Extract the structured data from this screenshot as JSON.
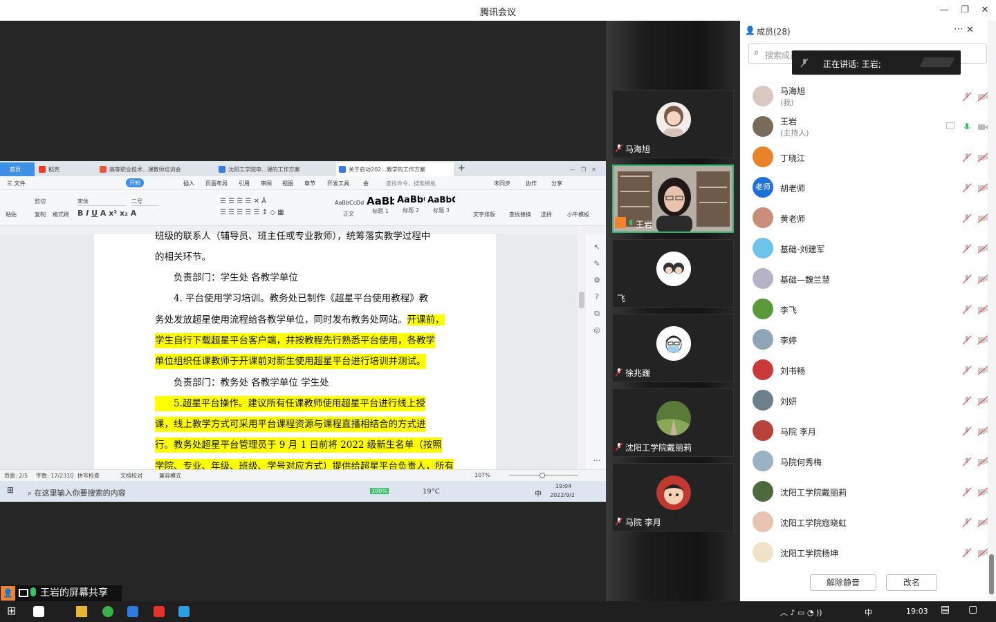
{
  "window": {
    "title": "腾讯会议"
  },
  "shared_screen": {
    "label": "王岩的屏幕共享",
    "wps_tabs": [
      "首页",
      "稻壳",
      "高等职业技术...课教师培训会",
      "沈阳工学院申...课的工作方案",
      "关于启动202...教学的工作方案"
    ],
    "menu": [
      "三 文件",
      "开始",
      "插入",
      "页面布局",
      "引用",
      "审阅",
      "视图",
      "章节",
      "开发工具",
      "会",
      "查找命令、搜索模板",
      "未同步",
      "协作",
      "分享"
    ],
    "ribbon": {
      "paste": "粘贴",
      "cut": "剪切",
      "copy": "复制",
      "format_painter": "格式刷",
      "font": "宋体",
      "size": "二号",
      "styles": [
        "正文",
        "标题 1",
        "标题 2",
        "标题 3"
      ],
      "style_previews": [
        "AaBbCcDd",
        "AaBb",
        "AaBbC",
        "AaBbC"
      ],
      "text_layout": "文字排版",
      "find_replace": "查找替换",
      "select": "选择",
      "template": "小牛模板"
    },
    "doc_lines": [
      {
        "text": "班级的联系人（辅导员、班主任或专业教师），统筹落实教学过程中",
        "hl": false
      },
      {
        "text": "的相关环节。",
        "hl": false
      },
      {
        "text": "　　负责部门：学生处 各教学单位",
        "hl": false
      },
      {
        "text": "　　4. 平台使用学习培训。教务处已制作《超星平台使用教程》教",
        "hl": false
      },
      {
        "text": "务处发放超星使用流程给各教学单位，同时发布教务处网站。",
        "hl": false,
        "hl_tail": "开课前，"
      },
      {
        "text": "学生自行下载超星平台客户端，并按教程先行熟悉平台使用，各教学",
        "hl": true
      },
      {
        "text": "单位组织任课教师于开课前对新生使用超星平台进行培训并测试。",
        "hl": true
      },
      {
        "text": "　　负责部门：教务处 各教学单位 学生处",
        "hl": false
      },
      {
        "text": "　　5.超星平台操作。建议所有任课教师使用超星平台进行线上授",
        "hl": true
      },
      {
        "text": "课，线上教学方式可采用平台课程资源与课程直播相结合的方式进",
        "hl": true
      },
      {
        "text": "行。教务处超星平台管理员于 9 月 1 日前将 2022 级新生名单（按照",
        "hl": true
      },
      {
        "text": "学院、专业、年级、班级、学号对应方式）提供给超星平台负责人，所有",
        "hl": true
      }
    ],
    "status": {
      "page": "页面: 2/5",
      "words": "字数: 17/2310",
      "spell": "拼写检查",
      "proof": "文档校对",
      "mode": "兼容模式",
      "zoom": "107%"
    },
    "win_taskbar": {
      "search": "在这里输入你要搜索的内容",
      "battery": "100%",
      "temp": "19°C",
      "ime": "中",
      "time": "19:04",
      "date": "2022/9/2"
    }
  },
  "gallery": [
    {
      "name": "马海旭",
      "avatar": "girl",
      "muted": true
    },
    {
      "name": "王岩",
      "avatar": "video",
      "muted": false,
      "active": true
    },
    {
      "name": "飞",
      "avatar": "couple",
      "muted": false
    },
    {
      "name": "徐兆巍",
      "avatar": "mask",
      "muted": true
    },
    {
      "name": "沈阳工学院戴丽莉",
      "avatar": "path",
      "muted": true
    },
    {
      "name": "马院 李月",
      "avatar": "cartoon",
      "muted": true
    }
  ],
  "members_panel": {
    "title": "成员(28)",
    "search_placeholder": "搜索成员",
    "speaking": "正在讲话: 王岩;",
    "members": [
      {
        "name": "马海旭",
        "sub": "(我)",
        "color": "#d9c7c0"
      },
      {
        "name": "王岩",
        "sub": "(主持人)",
        "color": "#7a6a5a",
        "host": true
      },
      {
        "name": "丁晓江",
        "color": "#e8832a"
      },
      {
        "name": "胡老师",
        "color": "#1e6fd9",
        "text": "老师"
      },
      {
        "name": "黄老师",
        "color": "#c98f7a"
      },
      {
        "name": "基础-刘建军",
        "color": "#6ec4e8"
      },
      {
        "name": "基础—魏兰慧",
        "color": "#b7b3c7"
      },
      {
        "name": "李飞",
        "color": "#5a9a3a"
      },
      {
        "name": "李婷",
        "color": "#8fa6b8"
      },
      {
        "name": "刘书畅",
        "color": "#c93a3a"
      },
      {
        "name": "刘妍",
        "color": "#6b7f8c"
      },
      {
        "name": "马院 李月",
        "color": "#b8413a"
      },
      {
        "name": "马院何秀梅",
        "color": "#9ab3c4"
      },
      {
        "name": "沈阳工学院戴丽莉",
        "color": "#4d6a3d"
      },
      {
        "name": "沈阳工学院寇晓虹",
        "color": "#e8c3b0"
      },
      {
        "name": "沈阳工学院杨坤",
        "color": "#f1e3c7"
      }
    ],
    "unmute_btn": "解除静音",
    "rename_btn": "改名"
  },
  "taskbar": {
    "time": "19:03",
    "ime": "中"
  }
}
